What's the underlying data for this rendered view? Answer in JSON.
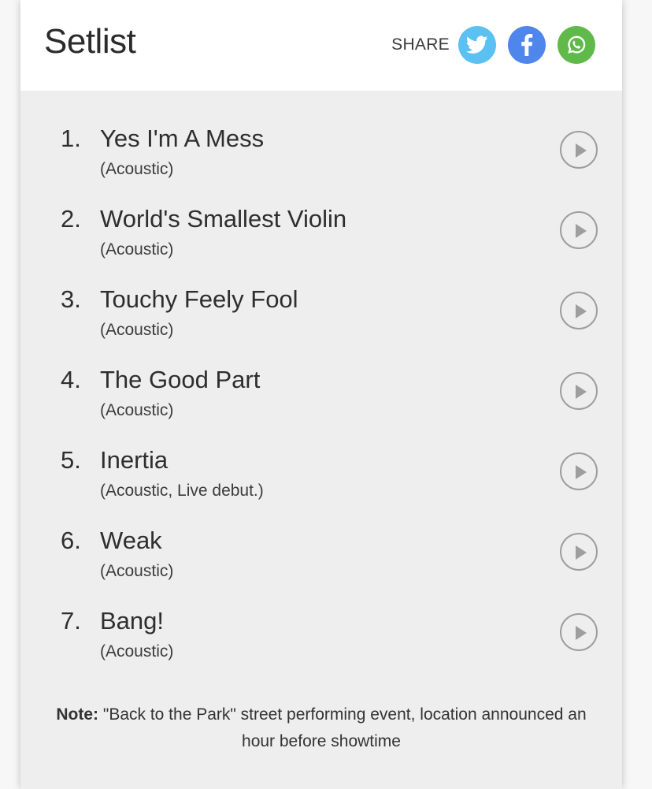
{
  "header": {
    "title": "Setlist",
    "share_label": "SHARE",
    "share_buttons": [
      {
        "name": "twitter",
        "icon": "twitter-icon",
        "color": "#5bc0f2"
      },
      {
        "name": "facebook",
        "icon": "facebook-icon",
        "color": "#4f86ec"
      },
      {
        "name": "whatsapp",
        "icon": "whatsapp-icon",
        "color": "#5fba4a"
      }
    ]
  },
  "setlist": {
    "songs": [
      {
        "number": "1.",
        "title": "Yes I'm A Mess",
        "info": "(Acoustic)"
      },
      {
        "number": "2.",
        "title": "World's Smallest Violin",
        "info": "(Acoustic)"
      },
      {
        "number": "3.",
        "title": "Touchy Feely Fool",
        "info": "(Acoustic)"
      },
      {
        "number": "4.",
        "title": "The Good Part",
        "info": "(Acoustic)"
      },
      {
        "number": "5.",
        "title": "Inertia",
        "info": "(Acoustic, Live debut.)"
      },
      {
        "number": "6.",
        "title": "Weak",
        "info": "(Acoustic)"
      },
      {
        "number": "7.",
        "title": "Bang!",
        "info": "(Acoustic)"
      }
    ],
    "play_icon": "play-circle-icon"
  },
  "note": {
    "label": "Note:",
    "text": "\"Back to the Park\" street performing event, location announced an hour before showtime"
  }
}
